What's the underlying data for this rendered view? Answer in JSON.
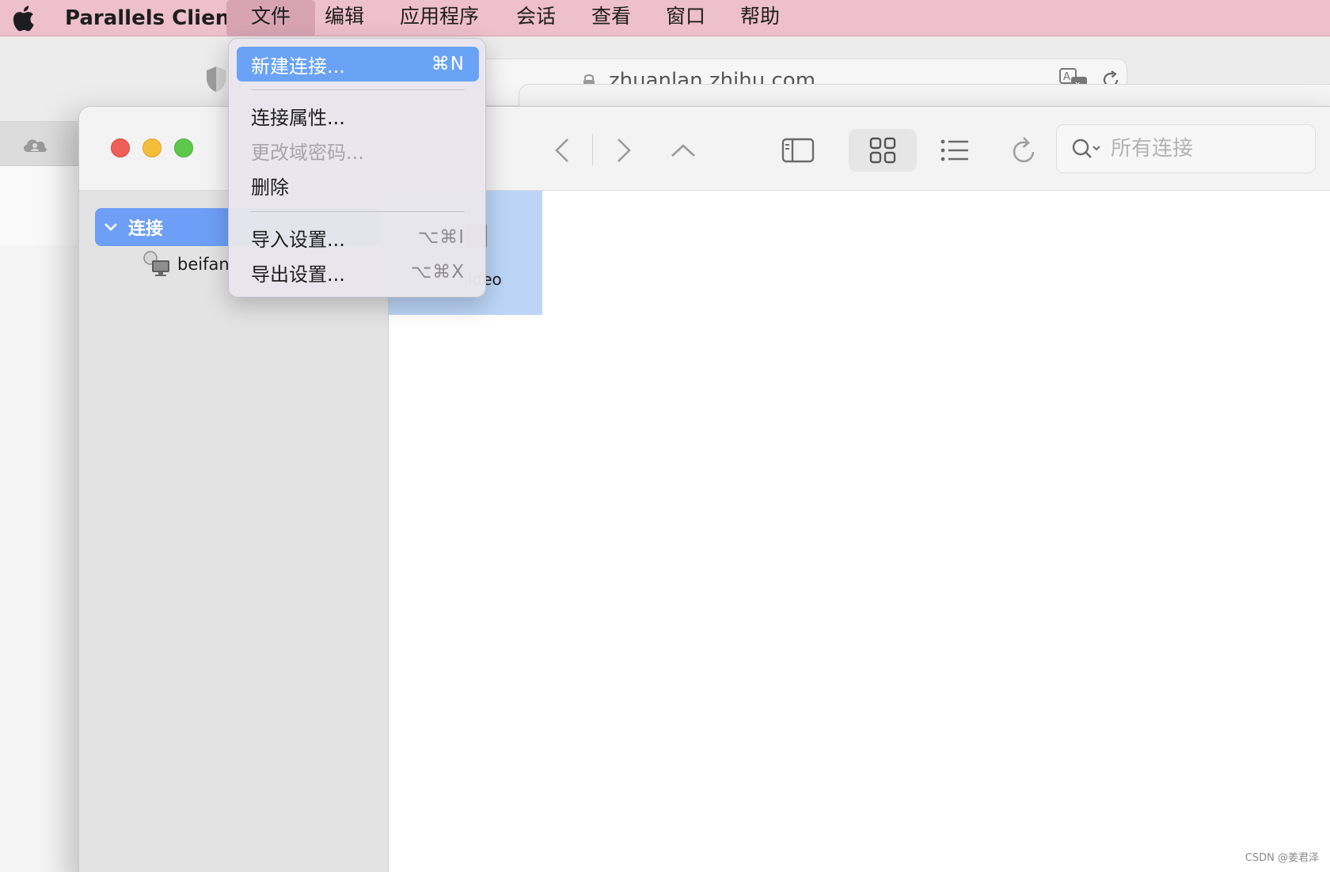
{
  "menubar": {
    "app_name": "Parallels Client",
    "items": [
      "文件",
      "编辑",
      "应用程序",
      "会话",
      "查看",
      "窗口",
      "帮助"
    ],
    "active_index": 0
  },
  "background_browser": {
    "url": "zhuanlan.zhihu.com"
  },
  "file_menu": {
    "items": [
      {
        "label": "新建连接...",
        "shortcut": "⌘N",
        "state": "highlighted"
      },
      {
        "label": "连接属性...",
        "shortcut": "",
        "state": "enabled"
      },
      {
        "label": "更改域密码...",
        "shortcut": "",
        "state": "disabled"
      },
      {
        "label": "删除",
        "shortcut": "",
        "state": "enabled"
      },
      {
        "label": "导入设置...",
        "shortcut": "⌥⌘I",
        "state": "enabled"
      },
      {
        "label": "导出设置...",
        "shortcut": "⌥⌘X",
        "state": "enabled"
      }
    ]
  },
  "toolbar": {
    "search_placeholder": "所有连接",
    "active_view": "grid"
  },
  "sidebar": {
    "group_label": "连接",
    "items": [
      {
        "label": "beifan"
      }
    ]
  },
  "content": {
    "tiles": [
      {
        "label": "ideo",
        "selected": true
      }
    ]
  },
  "watermark": "CSDN @姜君泽",
  "colors": {
    "menubar_bg": "#eebfcc",
    "accent_blue": "#6aa3f6",
    "sidebar_selected": "#6e9ff7",
    "tile_selected": "#bcd5f7"
  }
}
